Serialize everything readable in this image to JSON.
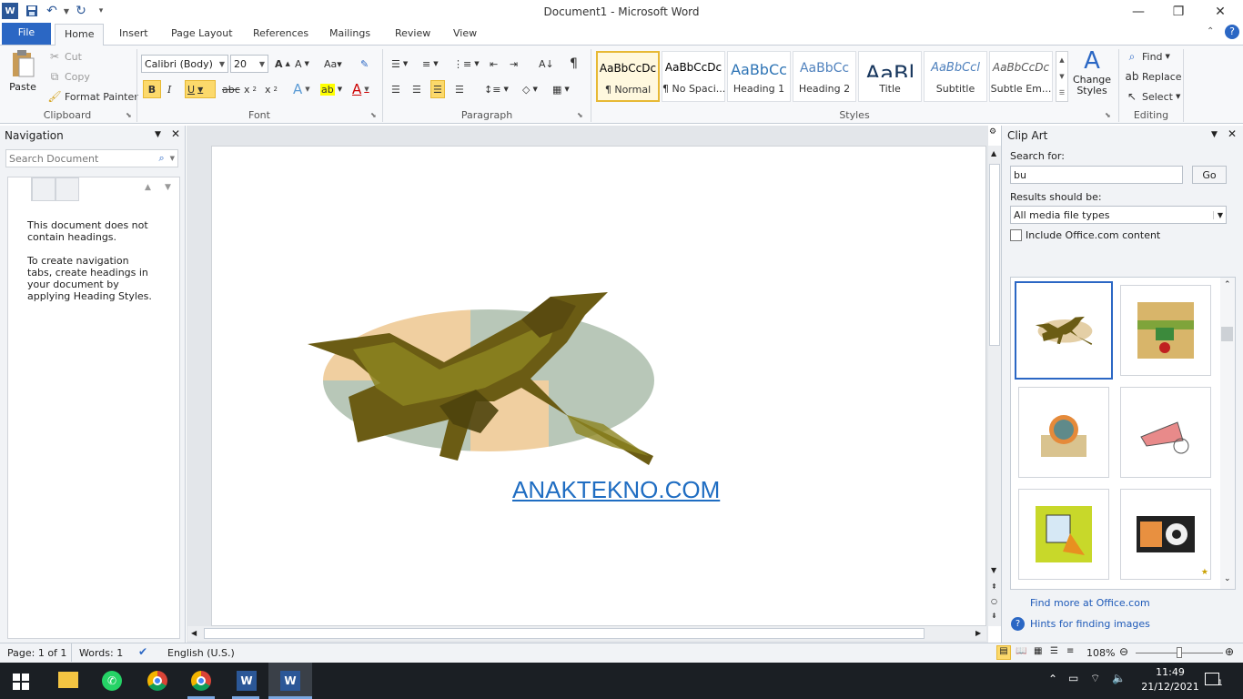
{
  "titlebar": {
    "title": "Document1  -  Microsoft Word"
  },
  "tabs": [
    "File",
    "Home",
    "Insert",
    "Page Layout",
    "References",
    "Mailings",
    "Review",
    "View"
  ],
  "clipboard": {
    "paste": "Paste",
    "cut": "Cut",
    "copy": "Copy",
    "format_painter": "Format Painter",
    "label": "Clipboard"
  },
  "font": {
    "name": "Calibri (Body)",
    "size": "20",
    "label": "Font",
    "bold": "B",
    "italic": "I",
    "underline": "U"
  },
  "paragraph": {
    "label": "Paragraph"
  },
  "styles": {
    "label": "Styles",
    "items": [
      {
        "sample": "AaBbCcDc",
        "name": "¶ Normal"
      },
      {
        "sample": "AaBbCcDc",
        "name": "¶ No Spaci..."
      },
      {
        "sample": "AaBbCc",
        "name": "Heading 1"
      },
      {
        "sample": "AaBbCc",
        "name": "Heading 2"
      },
      {
        "sample": "AaBl",
        "name": "Title"
      },
      {
        "sample": "AaBbCcl",
        "name": "Subtitle"
      },
      {
        "sample": "AaBbCcDc",
        "name": "Subtle Em..."
      }
    ],
    "change_styles": "Change Styles"
  },
  "editing": {
    "find": "Find",
    "replace": "Replace",
    "select": "Select",
    "label": "Editing"
  },
  "navigation": {
    "title": "Navigation",
    "search_placeholder": "Search Document",
    "msg1": "This document does not contain headings.",
    "msg2": "To create navigation tabs, create headings in your document by applying Heading Styles."
  },
  "document": {
    "link_text": "ANAKTEKNO.COM"
  },
  "clipart": {
    "title": "Clip Art",
    "search_for_label": "Search for:",
    "search_value": "bu",
    "go": "Go",
    "results_label": "Results should be:",
    "results_value": "All media file types",
    "include_label": "Include Office.com content",
    "find_more": "Find more at Office.com",
    "hints": "Hints for finding images"
  },
  "status": {
    "page": "Page: 1 of 1",
    "words": "Words: 1",
    "language": "English (U.S.)",
    "zoom": "108%"
  },
  "taskbar": {
    "time": "11:49",
    "date": "21/12/2021",
    "notifications": "1"
  },
  "colors": {
    "accent": "#2b67c4",
    "link": "#1f5ab8"
  }
}
